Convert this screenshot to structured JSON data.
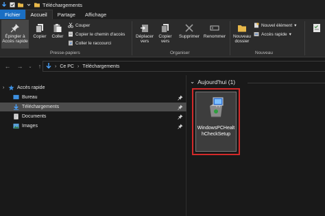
{
  "window": {
    "title": "Téléchargements"
  },
  "ribbon_tabs": [
    {
      "label": "Fichier"
    },
    {
      "label": "Accueil"
    },
    {
      "label": "Partage"
    },
    {
      "label": "Affichage"
    }
  ],
  "ribbon": {
    "pin_label": "Épingler à Accès rapide",
    "copy_label": "Copier",
    "paste_label": "Coller",
    "cut_label": "Couper",
    "copy_path_label": "Copier le chemin d'accès",
    "paste_shortcut_label": "Coller le raccourci",
    "clipboard_group": "Presse-papiers",
    "move_to_label": "Déplacer vers",
    "copy_to_label": "Copier vers",
    "delete_label": "Supprimer",
    "rename_label": "Renommer",
    "organize_group": "Organiser",
    "new_folder_label": "Nouveau dossier",
    "new_item_label": "Nouvel élément",
    "easy_access_label": "Accès rapide",
    "new_group": "Nouveau"
  },
  "address": {
    "crumbs": [
      "Ce PC",
      "Téléchargements"
    ]
  },
  "nav_pane": {
    "items": [
      {
        "label": "Accès rapide"
      },
      {
        "label": "Bureau"
      },
      {
        "label": "Téléchargements"
      },
      {
        "label": "Documents"
      },
      {
        "label": "Images"
      }
    ]
  },
  "content": {
    "group_header": "Aujourd'hui (1)",
    "files": [
      {
        "name": "WindowsPCHealthCheckSetup"
      }
    ]
  },
  "colors": {
    "accent": "#1a6fc4",
    "highlight_border": "#d42a2a",
    "selection": "#4c4c4c",
    "folder": "#e8b84a"
  }
}
